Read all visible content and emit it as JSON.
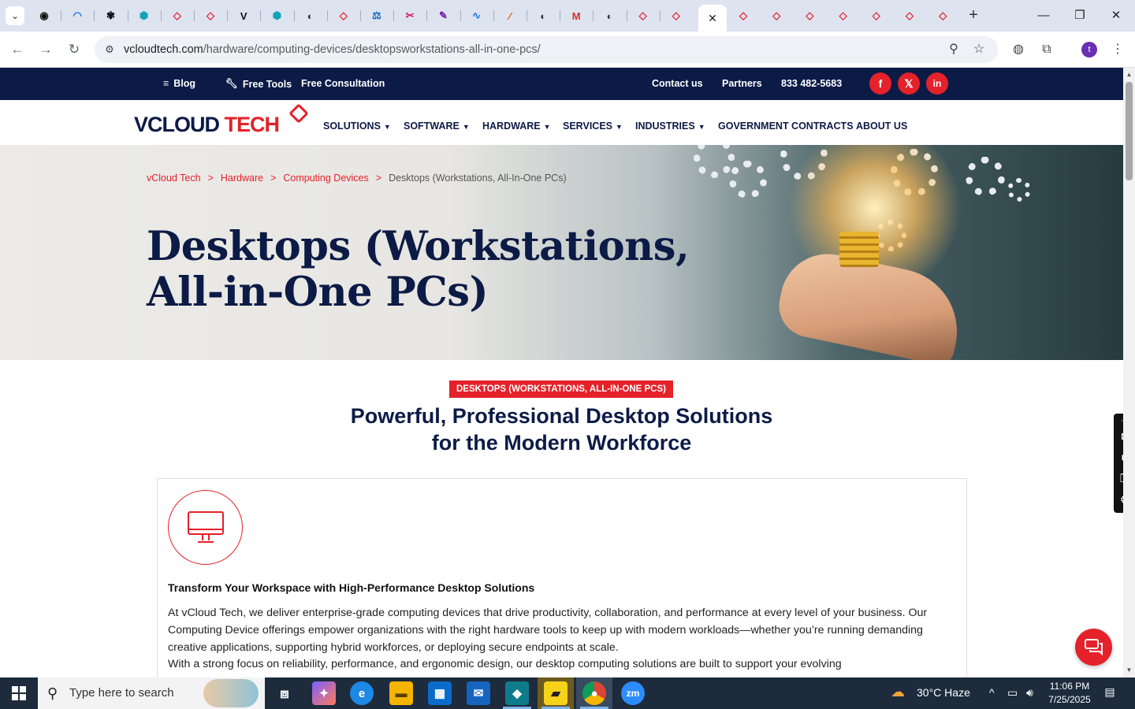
{
  "browser": {
    "tabs": [
      {
        "icon": "github-icon",
        "color": "#111111",
        "glyph": "◉"
      },
      {
        "icon": "wave-icon",
        "color": "#1a73e8",
        "glyph": "◠"
      },
      {
        "icon": "openai-icon",
        "color": "#111111",
        "glyph": "✾"
      },
      {
        "icon": "hexagon-icon",
        "color": "#13a3b8",
        "glyph": "⬢"
      },
      {
        "icon": "vcloud-icon",
        "color": "#e5212a",
        "glyph": "◇"
      },
      {
        "icon": "vcloud-icon",
        "color": "#e5212a",
        "glyph": "◇"
      },
      {
        "icon": "v-check-icon",
        "color": "#111111",
        "glyph": "V"
      },
      {
        "icon": "hexagon-icon",
        "color": "#13a3b8",
        "glyph": "⬢"
      },
      {
        "icon": "globe-icon",
        "color": "#333333",
        "glyph": "◐"
      },
      {
        "icon": "vcloud-icon",
        "color": "#e5212a",
        "glyph": "◇"
      },
      {
        "icon": "scales-icon",
        "color": "#1565c0",
        "glyph": "⚖"
      },
      {
        "icon": "clip-icon",
        "color": "#d81b60",
        "glyph": "✂"
      },
      {
        "icon": "pen-icon",
        "color": "#7b1fa2",
        "glyph": "✎"
      },
      {
        "icon": "pulse-icon",
        "color": "#1a73e8",
        "glyph": "∿"
      },
      {
        "icon": "slash-icon",
        "color": "#e65100",
        "glyph": "⁄"
      },
      {
        "icon": "globe-icon",
        "color": "#333333",
        "glyph": "◐"
      },
      {
        "icon": "gmail-icon",
        "color": "#d93025",
        "glyph": "M"
      },
      {
        "icon": "globe-icon",
        "color": "#333333",
        "glyph": "◐"
      },
      {
        "icon": "vcloud-icon",
        "color": "#e5212a",
        "glyph": "◇"
      },
      {
        "icon": "vcloud-icon",
        "color": "#e5212a",
        "glyph": "◇"
      }
    ],
    "tabs_after": [
      {
        "icon": "vcloud-icon",
        "color": "#e5212a",
        "glyph": "◇"
      },
      {
        "icon": "vcloud-icon",
        "color": "#e5212a",
        "glyph": "◇"
      },
      {
        "icon": "vcloud-icon",
        "color": "#e5212a",
        "glyph": "◇"
      },
      {
        "icon": "vcloud-icon",
        "color": "#e5212a",
        "glyph": "◇"
      },
      {
        "icon": "vcloud-icon",
        "color": "#e5212a",
        "glyph": "◇"
      },
      {
        "icon": "vcloud-icon",
        "color": "#e5212a",
        "glyph": "◇"
      },
      {
        "icon": "vcloud-icon",
        "color": "#e5212a",
        "glyph": "◇"
      }
    ],
    "url_host": "vcloudtech.com",
    "url_path": "/hardware/computing-devices/desktopsworkstations-all-in-one-pcs/",
    "profile_initial": "t"
  },
  "site": {
    "topbar": {
      "blog": "Blog",
      "free_tools": "Free Tools",
      "free_consultation": "Free Consultation",
      "contact": "Contact us",
      "partners": "Partners",
      "phone": "833 482-5683",
      "social": [
        "f",
        "𝕏",
        "in"
      ]
    },
    "logo_v": "V",
    "logo_cloud": "CLOUD ",
    "logo_tech": "TECH",
    "nav": {
      "solutions": "SOLUTIONS",
      "software": "SOFTWARE",
      "hardware": "HARDWARE",
      "services": "SERVICES",
      "industries": "INDUSTRIES",
      "gov": "GOVERNMENT CONTRACTS",
      "about": "ABOUT US"
    },
    "breadcrumb": {
      "home": "vCloud Tech",
      "hardware": "Hardware",
      "computing": "Computing Devices",
      "current": "Desktops (Workstations, All-In-One PCs)",
      "sep": ">"
    },
    "hero_title_line1": "Desktops (Workstations,",
    "hero_title_line2": "All-in-One PCs)",
    "tag": "DESKTOPS (WORKSTATIONS, ALL-IN-ONE PCS)",
    "heading_line1": "Powerful, Professional Desktop Solutions",
    "heading_line2": "for the Modern Workforce",
    "card": {
      "title": "Transform Your Workspace with High-Performance Desktop Solutions",
      "para1": "At vCloud Tech, we deliver enterprise-grade computing devices that drive productivity, collaboration, and performance at every level of your business. Our Computing Device offerings empower organizations with the right hardware tools to keep up with modern workloads—whether you’re running demanding creative applications, supporting hybrid workforces, or deploying secure endpoints at scale.",
      "para2": "With a strong focus on reliability, performance, and ergonomic design, our desktop computing solutions are built to support your evolving"
    }
  },
  "taskbar": {
    "search_placeholder": "Type here to search",
    "weather": "30°C  Haze",
    "time": "11:06 PM",
    "date": "7/25/2025"
  },
  "colors": {
    "brand_red": "#e5212a",
    "brand_navy": "#0c1b46"
  }
}
